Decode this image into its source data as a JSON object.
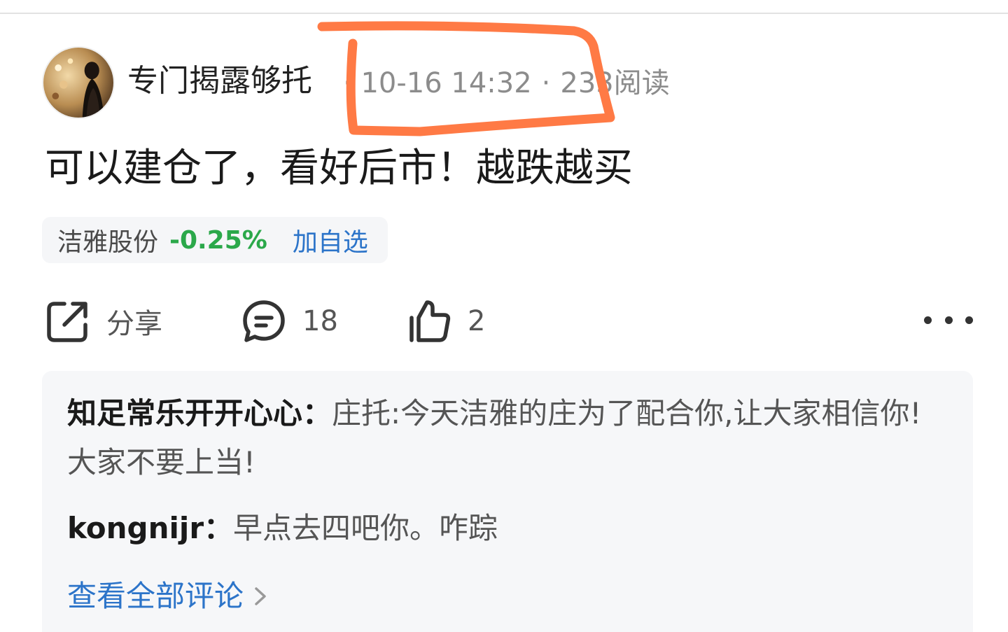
{
  "header": {
    "author": "专门揭露够托",
    "date": "10-16 14:32",
    "separator": "·",
    "read_count": "233",
    "read_label": "阅读"
  },
  "post": {
    "text": "可以建仓了，看好后市！越跌越买"
  },
  "stock": {
    "name": "洁雅股份",
    "change": "-0.25%",
    "add_watch": "加自选",
    "change_color": "#2ba84a"
  },
  "actions": {
    "share_label": "分享",
    "comment_count": "18",
    "like_count": "2"
  },
  "comments": [
    {
      "user": "知足常乐开开心心",
      "colon": "：",
      "text": "庄托:今天洁雅的庄为了配合你,让大家相信你!大家不要上当!"
    },
    {
      "user": "kongnijr",
      "colon": "：",
      "text": "早点去四吧你。咋踪"
    }
  ],
  "view_all_comments": "查看全部评论",
  "colors": {
    "accent_blue": "#2c74c9",
    "annotation_orange": "#ff7a45"
  }
}
